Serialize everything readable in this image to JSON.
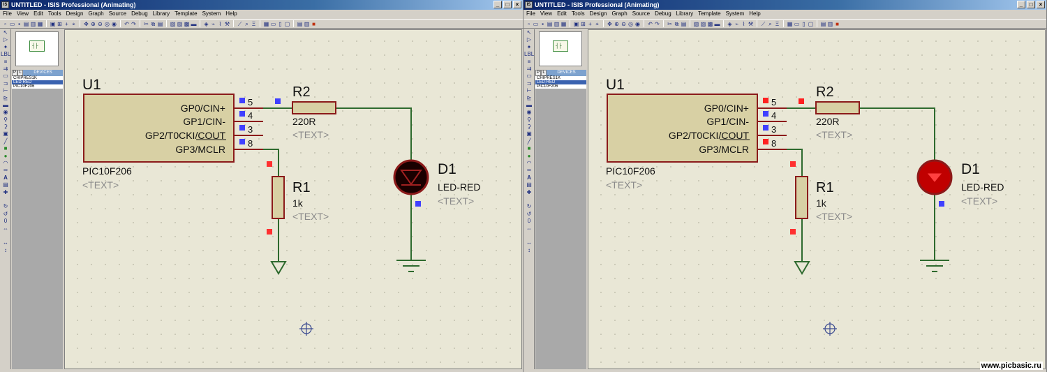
{
  "watermark": "www.picbasic.ru",
  "windows": [
    {
      "title": "UNTITLED - ISIS Professional (Animating)",
      "menu": [
        "File",
        "View",
        "Edit",
        "Tools",
        "Design",
        "Graph",
        "Source",
        "Debug",
        "Library",
        "Template",
        "System",
        "Help"
      ],
      "devices_tab": "DEVICES",
      "picker_buttons": [
        "P",
        "L"
      ],
      "devices": [
        "CHIPRES1K",
        "LED-RED",
        "PIC10F206"
      ],
      "selected_device": "LED-RED",
      "led_lit": false,
      "colors": {
        "led_fill": "#1a0000",
        "pin_high": "#4040ff",
        "pin_mark_r2": "#4040ff"
      },
      "schematic": {
        "u1": {
          "ref": "U1",
          "value": "PIC10F206",
          "text": "<TEXT>",
          "pins": [
            {
              "name": "GP0/CIN+",
              "num": "5",
              "state": "low"
            },
            {
              "name": "GP1/CIN-",
              "num": "4",
              "state": "low"
            },
            {
              "name": "GP2/T0CKI/COUT",
              "num": "3",
              "state": "low"
            },
            {
              "name": "GP3/MCLR",
              "num": "8",
              "state": "high"
            }
          ]
        },
        "r2": {
          "ref": "R2",
          "value": "220R",
          "text": "<TEXT>"
        },
        "r1": {
          "ref": "R1",
          "value": "1k",
          "text": "<TEXT>"
        },
        "d1": {
          "ref": "D1",
          "value": "LED-RED",
          "text": "<TEXT>"
        }
      }
    },
    {
      "title": "UNTITLED - ISIS Professional (Animating)",
      "menu": [
        "File",
        "View",
        "Edit",
        "Tools",
        "Design",
        "Graph",
        "Source",
        "Debug",
        "Library",
        "Template",
        "System",
        "Help"
      ],
      "devices_tab": "DEVICES",
      "picker_buttons": [
        "P",
        "L"
      ],
      "devices": [
        "CHIPRES1K",
        "LED-RED",
        "PIC10F206"
      ],
      "selected_device": "LED-RED",
      "led_lit": true,
      "colors": {
        "led_fill": "#c00000",
        "pin_high": "#ff2020",
        "pin_mark_r2": "#ff2020"
      },
      "schematic": {
        "u1": {
          "ref": "U1",
          "value": "PIC10F206",
          "text": "<TEXT>",
          "pins": [
            {
              "name": "GP0/CIN+",
              "num": "5",
              "state": "high"
            },
            {
              "name": "GP1/CIN-",
              "num": "4",
              "state": "low"
            },
            {
              "name": "GP2/T0CKI/COUT",
              "num": "3",
              "state": "low"
            },
            {
              "name": "GP3/MCLR",
              "num": "8",
              "state": "high"
            }
          ]
        },
        "r2": {
          "ref": "R2",
          "value": "220R",
          "text": "<TEXT>"
        },
        "r1": {
          "ref": "R1",
          "value": "1k",
          "text": "<TEXT>"
        },
        "d1": {
          "ref": "D1",
          "value": "LED-RED",
          "text": "<TEXT>"
        }
      }
    }
  ]
}
